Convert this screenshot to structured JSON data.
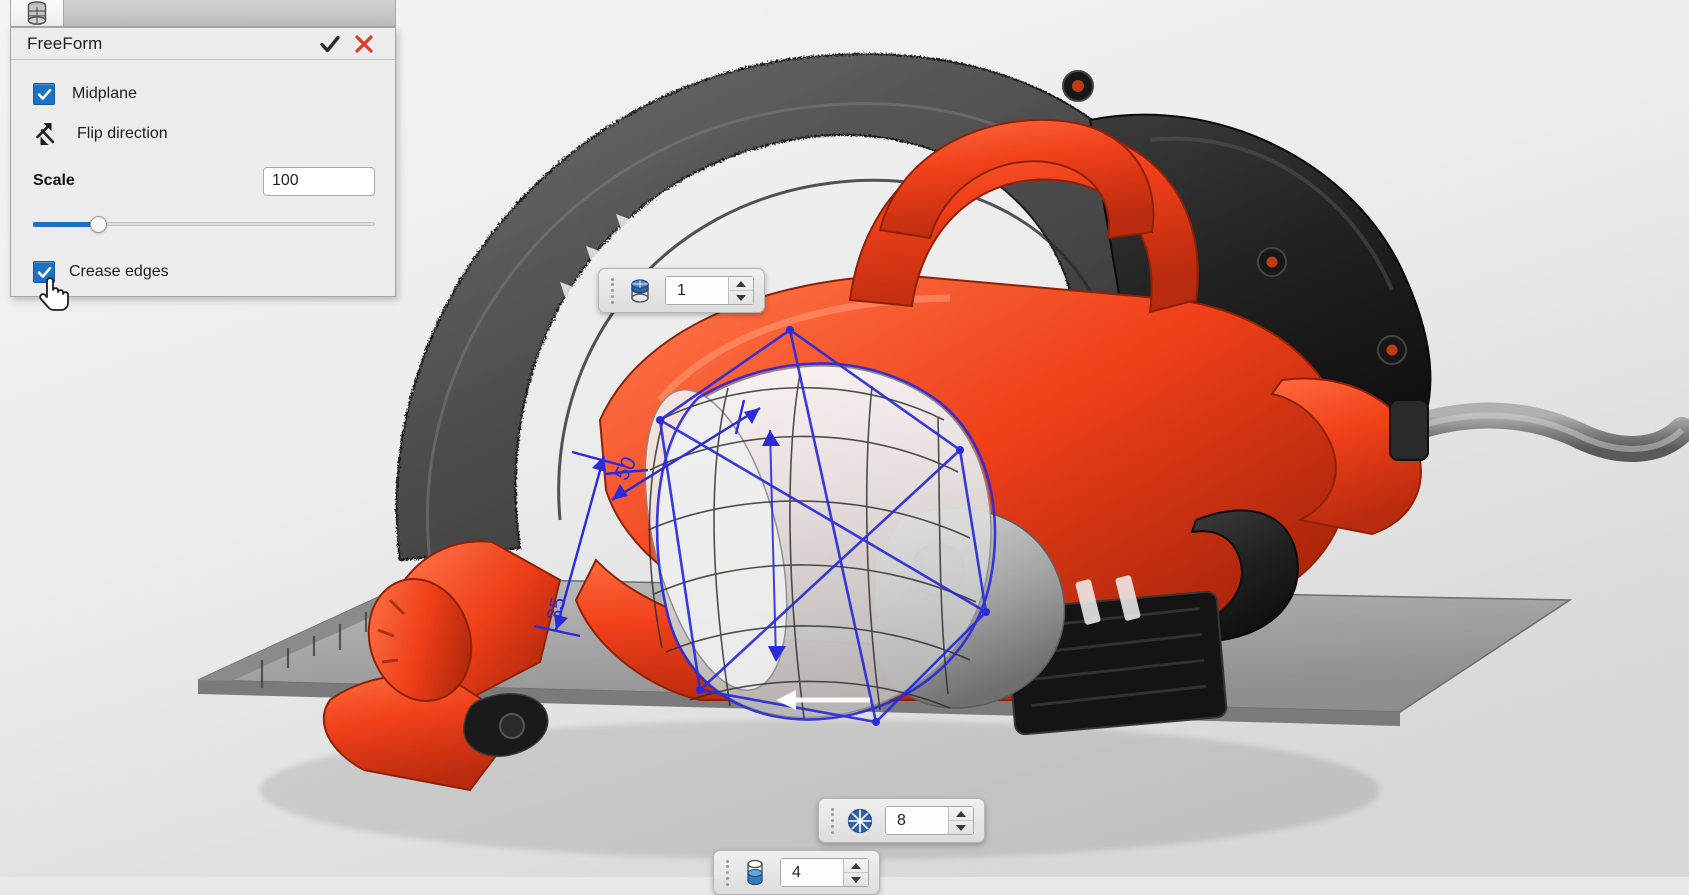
{
  "app": {
    "tab_icon": "cylinder-database-icon"
  },
  "panel": {
    "title": "FreeForm",
    "confirm_icon": "checkmark-icon",
    "cancel_icon": "close-x-icon",
    "accent_blue": "#1b72c4",
    "cancel_red": "#e03a27",
    "midplane": {
      "label": "Midplane",
      "checked": true
    },
    "flip_direction": {
      "label": "Flip direction",
      "icon": "flip-direction-arrows-icon"
    },
    "scale": {
      "label": "Scale",
      "value": "100",
      "placeholder": "100",
      "slider_percent": 19
    },
    "crease_edges": {
      "label": "Crease edges",
      "checked": true
    }
  },
  "toolbars": [
    {
      "id": "toolbar-1",
      "icon": "blue-capped-cylinder-icon",
      "value": "1",
      "grip_icon": "drag-grip-dots-icon",
      "spin_up_icon": "arrow-up-icon",
      "spin_down_icon": "arrow-down-icon"
    },
    {
      "id": "toolbar-2",
      "icon": "blue-radial-segments-icon",
      "value": "8",
      "grip_icon": "drag-grip-dots-icon",
      "spin_up_icon": "arrow-up-icon",
      "spin_down_icon": "arrow-down-icon"
    },
    {
      "id": "toolbar-3",
      "icon": "blue-filled-beaker-icon",
      "value": "4",
      "grip_icon": "drag-grip-dots-icon",
      "spin_up_icon": "arrow-up-icon",
      "spin_down_icon": "arrow-down-icon"
    }
  ],
  "viewport": {
    "name": "3d-model-viewport",
    "model": "circular-saw-power-tool",
    "dimension_labels": [
      "50",
      "35"
    ],
    "colors": {
      "body_orange": "#f03f18",
      "body_dark": "#2a2a2a",
      "blade_guard_grey": "#4a4a4a",
      "base_plate_grey": "#9a9a9a",
      "sketch_blue": "#2b2bd8",
      "background": "#eaeaea"
    }
  }
}
